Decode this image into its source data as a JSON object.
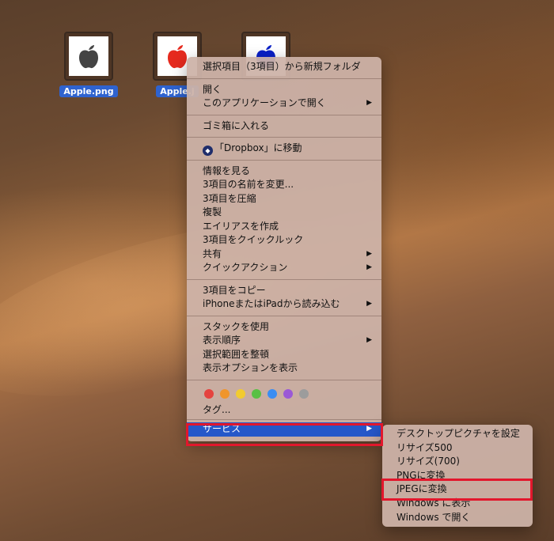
{
  "desktop": {
    "icons": [
      {
        "label": "Apple.png",
        "color": "#444444"
      },
      {
        "label": "Apple.j",
        "color": "#e62a1e"
      },
      {
        "label": "",
        "color": "#0a20c8"
      }
    ]
  },
  "context_menu": {
    "new_folder": "選択項目（3項目）から新規フォルダ",
    "open": "開く",
    "open_with": "このアプリケーションで開く",
    "trash": "ゴミ箱に入れる",
    "dropbox": "「Dropbox」に移動",
    "get_info": "情報を見る",
    "rename": "3項目の名前を変更...",
    "compress": "3項目を圧縮",
    "duplicate": "複製",
    "alias": "エイリアスを作成",
    "quicklook": "3項目をクイックルック",
    "share": "共有",
    "quick_actions": "クイックアクション",
    "copy": "3項目をコピー",
    "import_iphone": "iPhoneまたはiPadから読み込む",
    "use_stacks": "スタックを使用",
    "sort_by": "表示順序",
    "clean_up": "選択範囲を整頓",
    "view_options": "表示オプションを表示",
    "tags_label": "タグ...",
    "services": "サービス",
    "submenu_arrow": "▶",
    "tag_colors": [
      "#e5433f",
      "#f0952c",
      "#f2cb2f",
      "#58c044",
      "#3b8df2",
      "#9b59d6",
      "#9c9c9c"
    ]
  },
  "services_menu": {
    "set_desktop": "デスクトップピクチャを設定",
    "resize_500": "リサイズ500",
    "resize_700": "リサイズ(700)",
    "to_png": "PNGに変換",
    "to_jpeg": "JPEGに変換",
    "show_windows": "Windows に表示",
    "open_windows": "Windows で開く"
  },
  "colors": {
    "highlight": "#2557c9",
    "annotation": "#e2172c"
  }
}
